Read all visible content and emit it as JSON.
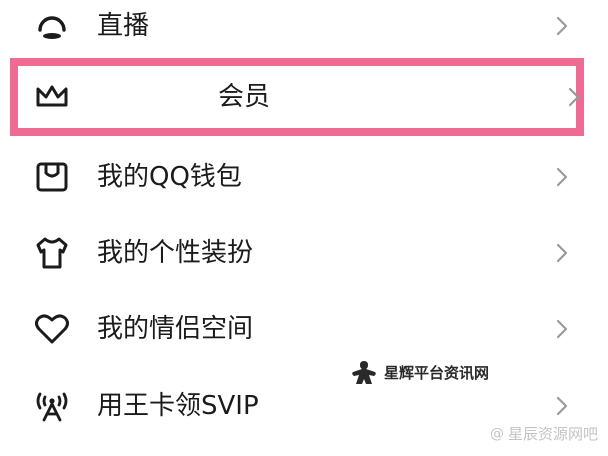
{
  "menu": {
    "items": [
      {
        "label": "直播",
        "icon": "live-icon"
      },
      {
        "label": "会员",
        "icon": "crown-icon",
        "highlighted": true
      },
      {
        "label": "我的QQ钱包",
        "icon": "wallet-icon"
      },
      {
        "label": "我的个性装扮",
        "icon": "tshirt-icon"
      },
      {
        "label": "我的情侣空间",
        "icon": "heart-icon"
      },
      {
        "label": "用王卡领SVIP",
        "icon": "antenna-icon"
      }
    ]
  },
  "highlight_color": "#ef6b93",
  "watermark": {
    "icon": "meeple-icon",
    "text": "星辉平台资讯网"
  },
  "footer": {
    "at_symbol": "@",
    "text": "星辰资源网吧"
  }
}
